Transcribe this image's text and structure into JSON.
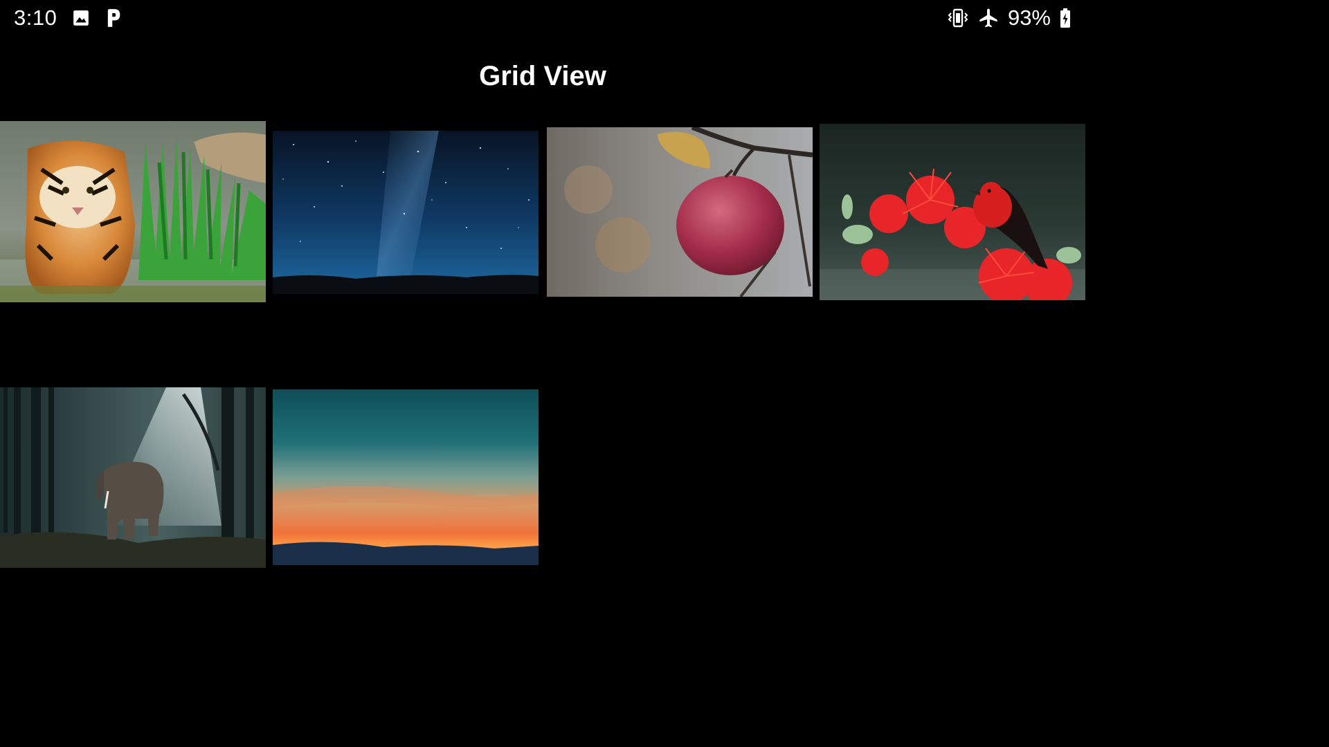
{
  "status_bar": {
    "time": "3:10",
    "left_icons": [
      "image-notification-icon",
      "parking-app-icon"
    ],
    "right_icons": [
      "vibrate-icon",
      "airplane-mode-icon",
      "battery-charging-icon"
    ],
    "battery_percent": "93%"
  },
  "header": {
    "title": "Grid View"
  },
  "grid": {
    "columns": 4,
    "items": [
      {
        "subject": "tiger-in-water"
      },
      {
        "subject": "starry-night-sky"
      },
      {
        "subject": "red-apple-on-branch"
      },
      {
        "subject": "red-bird-on-flowers"
      },
      {
        "subject": "elephant-in-forest"
      },
      {
        "subject": "sunset-sky"
      }
    ]
  }
}
